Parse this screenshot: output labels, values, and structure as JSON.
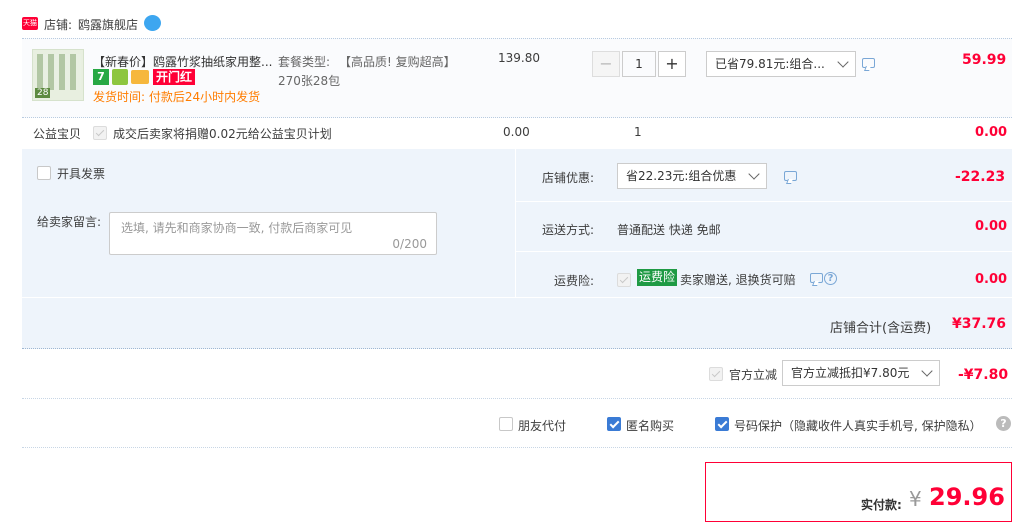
{
  "shop": {
    "badge": "天猫",
    "label": "店铺:",
    "name": "鸥露旗舰店"
  },
  "product": {
    "thumb_tag": "28",
    "title": "【新春价】鸥露竹浆抽纸家用整...",
    "tag_seven": "7",
    "tag_kaimen": "开门红",
    "delivery": "发货时间: 付款后24小时内发货",
    "package_label": "套餐类型:",
    "package_value": "【高品质! 复购超高】",
    "package_value2": "270张28包",
    "price": "139.80",
    "quantity": "1",
    "promo_select": "已省79.81元:组合...",
    "subtotal": "59.99"
  },
  "charity": {
    "label": "公益宝贝",
    "text": "成交后卖家将捐赠0.02元给公益宝贝计划",
    "price": "0.00",
    "quantity": "1",
    "subtotal": "0.00"
  },
  "invoice": {
    "label": "开具发票"
  },
  "message": {
    "label": "给卖家留言:",
    "placeholder": "选填, 请先和商家协商一致, 付款后商家可见",
    "count": "0/200"
  },
  "shop_discount": {
    "label": "店铺优惠:",
    "select": "省22.23元:组合优惠",
    "amount": "-22.23"
  },
  "shipping": {
    "label": "运送方式:",
    "value": "普通配送 快递 免邮",
    "amount": "0.00"
  },
  "insurance": {
    "label": "运费险:",
    "badge": "运费险",
    "text": "卖家赠送, 退换货可赔",
    "amount": "0.00"
  },
  "shop_total": {
    "label": "店铺合计(含运费)",
    "amount": "¥37.76"
  },
  "official": {
    "label": "官方立减",
    "select": "官方立减抵扣¥7.80元",
    "amount": "-¥7.80"
  },
  "options": {
    "friend_pay": "朋友代付",
    "anonymous": "匿名购买",
    "number_protect": "号码保护（隐藏收件人真实手机号, 保护隐私）"
  },
  "payment": {
    "label": "实付款:",
    "currency": "¥",
    "amount": "29.96"
  },
  "colors": {
    "accent_red": "#ff0036",
    "panel_blue": "#eef4fb",
    "checkbox_blue": "#3a7bd5"
  }
}
